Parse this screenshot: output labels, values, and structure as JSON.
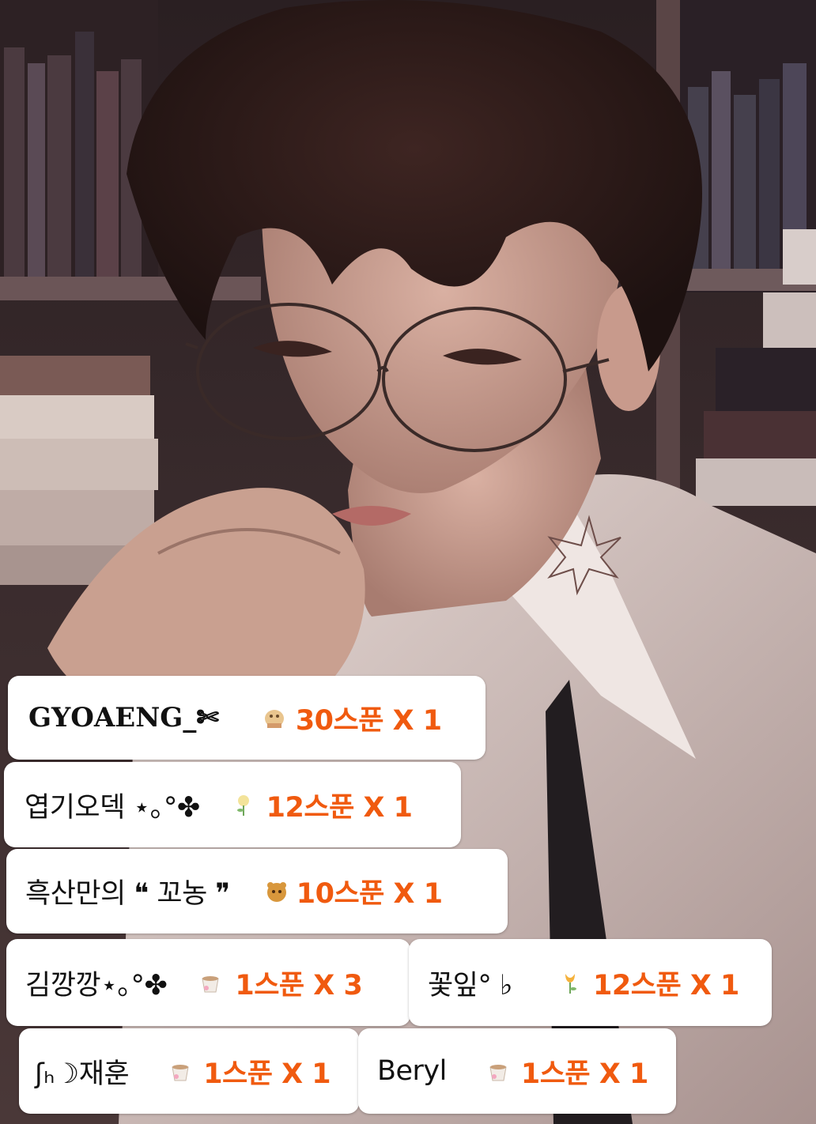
{
  "colors": {
    "chip_background": "#ffffff",
    "name_text": "#111111",
    "amount_text": "#f05a0f"
  },
  "background": {
    "subject": "illustrated portrait with books",
    "icon": "portrait-artwork"
  },
  "donations": [
    {
      "name": "GYOAENG_✄",
      "icon": "bread-sticker-icon",
      "amount": "30스푼 X 1"
    },
    {
      "name": "엽기오덱 ⋆｡°✤",
      "icon": "rose-icon",
      "amount": "12스푼 X 1"
    },
    {
      "name": "흑산만의 ❝ 꼬농 ❞",
      "icon": "cookie-bear-icon",
      "amount": "10스푼 X 1"
    },
    {
      "name": "김깡깡⋆｡°✤",
      "icon": "coffee-cup-icon",
      "amount": "1스푼 X 3"
    },
    {
      "name": "꽃잎° ♭",
      "icon": "tulip-icon",
      "amount": "12스푼 X 1"
    },
    {
      "name": "ʃₕ☽재훈",
      "icon": "coffee-cup-icon",
      "amount": "1스푼 X 1"
    },
    {
      "name": "Beryl",
      "icon": "coffee-cup-icon",
      "amount": "1스푼 X 1"
    }
  ]
}
